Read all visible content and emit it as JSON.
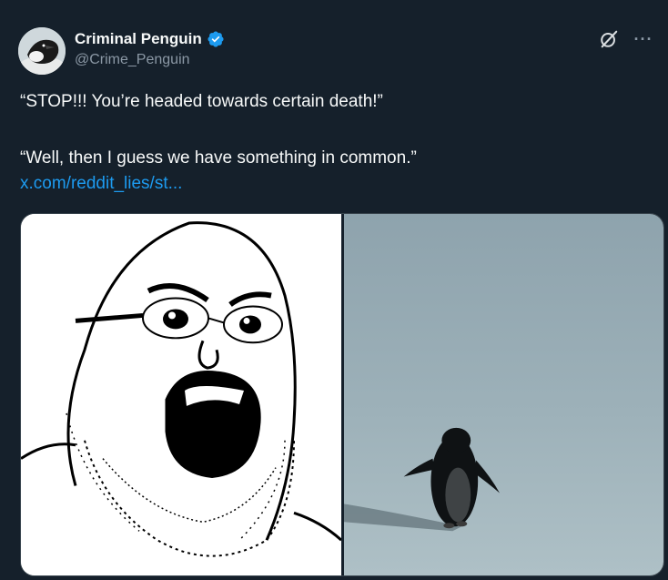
{
  "author": {
    "display_name": "Criminal Penguin",
    "handle": "@Crime_Penguin",
    "verified": true,
    "avatar_icon": "penguin-avatar"
  },
  "actions": {
    "grok_icon": "grok-icon",
    "more_icon": "more-icon",
    "more_label": "···"
  },
  "tweet": {
    "line1": "“STOP!!! You’re headed towards certain death!”",
    "line2": "“Well, then I guess we have something in common.”",
    "link_text": "x.com/reddit_lies/st..."
  },
  "media": {
    "left_image": "soyjak-yelling-meme",
    "right_image": "penguin-walking-on-ice"
  },
  "colors": {
    "background": "#15202b",
    "text": "#f7f9f9",
    "secondary": "#8b98a5",
    "link": "#1d9bf0",
    "verified": "#1d9bf0"
  }
}
